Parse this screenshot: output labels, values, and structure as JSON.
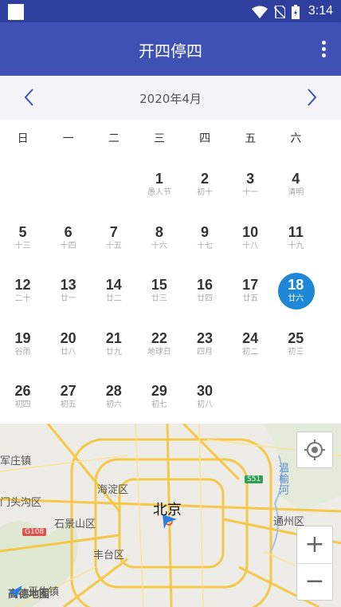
{
  "status": {
    "time": "3:14"
  },
  "app": {
    "title": "开四停四"
  },
  "calendar": {
    "month_label": "2020年4月",
    "weekdays": [
      "日",
      "一",
      "二",
      "三",
      "四",
      "五",
      "六"
    ],
    "weeks": [
      [
        null,
        null,
        null,
        {
          "day": "1",
          "sub": "愚人节"
        },
        {
          "day": "2",
          "sub": "初十"
        },
        {
          "day": "3",
          "sub": "十一"
        },
        {
          "day": "4",
          "sub": "清明"
        }
      ],
      [
        {
          "day": "5",
          "sub": "十三"
        },
        {
          "day": "6",
          "sub": "十四"
        },
        {
          "day": "7",
          "sub": "十五"
        },
        {
          "day": "8",
          "sub": "十六"
        },
        {
          "day": "9",
          "sub": "十七"
        },
        {
          "day": "10",
          "sub": "十八"
        },
        {
          "day": "11",
          "sub": "十九"
        }
      ],
      [
        {
          "day": "12",
          "sub": "二十"
        },
        {
          "day": "13",
          "sub": "廿一"
        },
        {
          "day": "14",
          "sub": "廿二"
        },
        {
          "day": "15",
          "sub": "廿三"
        },
        {
          "day": "16",
          "sub": "廿四"
        },
        {
          "day": "17",
          "sub": "廿五"
        },
        {
          "day": "18",
          "sub": "廿六",
          "selected": true
        }
      ],
      [
        {
          "day": "19",
          "sub": "谷雨"
        },
        {
          "day": "20",
          "sub": "廿八"
        },
        {
          "day": "21",
          "sub": "廿九"
        },
        {
          "day": "22",
          "sub": "地球日"
        },
        {
          "day": "23",
          "sub": "四月"
        },
        {
          "day": "24",
          "sub": "初二"
        },
        {
          "day": "25",
          "sub": "初三"
        }
      ],
      [
        {
          "day": "26",
          "sub": "初四"
        },
        {
          "day": "27",
          "sub": "初五"
        },
        {
          "day": "28",
          "sub": "初六"
        },
        {
          "day": "29",
          "sub": "初七"
        },
        {
          "day": "30",
          "sub": "初八"
        },
        null,
        null
      ]
    ]
  },
  "map": {
    "labels": {
      "l1": "军庄镇",
      "l2": "门头沟区",
      "l3": "海淀区",
      "l4": "石景山区",
      "l5": "北京",
      "l6": "丰台区",
      "l7": "通州区",
      "l8": "温榆河",
      "l9": "王佐镇"
    },
    "roads": {
      "r1": "S51",
      "r2": "G108"
    },
    "logo": "高德地图",
    "zoom_in": "+",
    "zoom_out": "−"
  },
  "colors": {
    "app_bar": "#3f51b5",
    "selected": "#1e88d6",
    "accent": "#3f51b5"
  }
}
